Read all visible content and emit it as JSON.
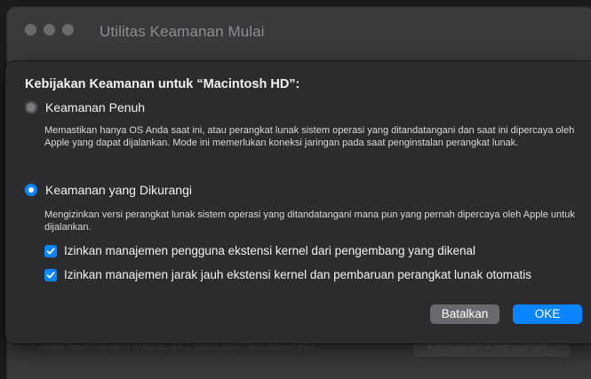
{
  "background_window": {
    "title": "Utilitas Keamanan Mulai",
    "status_text": "Anda telah memilih macOS 14.1 pada disk \"Macintosh HD\".",
    "policy_button_label": "Kebijakan Keamanan..."
  },
  "sheet": {
    "heading": "Kebijakan Keamanan untuk “Macintosh HD”:",
    "full_security": {
      "label": "Keamanan Penuh",
      "selected": false,
      "description": "Memastikan hanya OS Anda saat ini, atau perangkat lunak sistem operasi yang ditandatangani dan saat ini dipercaya oleh Apple yang dapat dijalankan. Mode ini memerlukan koneksi jaringan pada saat penginstalan perangkat lunak."
    },
    "reduced_security": {
      "label": "Keamanan yang Dikurangi",
      "selected": true,
      "description": "Mengizinkan versi perangkat lunak sistem operasi yang ditandatangani mana pun yang pernah dipercaya oleh Apple untuk dijalankan.",
      "options": [
        {
          "label": "Izinkan manajemen pengguna ekstensi kernel dari pengembang yang dikenal",
          "checked": true
        },
        {
          "label": "Izinkan manajemen jarak jauh ekstensi kernel dan pembaruan perangkat lunak otomatis",
          "checked": true
        }
      ]
    },
    "buttons": {
      "cancel": "Batalkan",
      "ok": "OKE"
    }
  },
  "colors": {
    "accent": "#0a84ff",
    "sheet_background": "#2c2c2e",
    "window_background": "#3a3a3c"
  }
}
